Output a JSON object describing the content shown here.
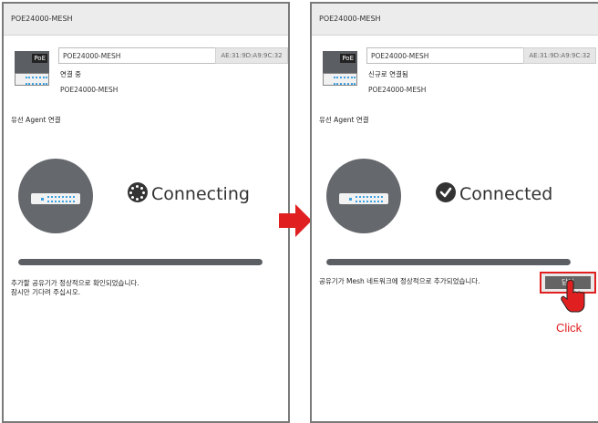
{
  "left_panel": {
    "title": "POE24000-MESH",
    "device_name": "POE24000-MESH",
    "mac": "AE:31:9D:A9:9C:32",
    "status": "연결 중",
    "model": "POE24000-MESH",
    "section_label": "유선 Agent 연결",
    "big_status": "Connecting",
    "progress": 1.0,
    "message_line1": "추가할 공유기가 정상적으로 확인되었습니다.",
    "message_line2": "잠시만 기다려 주십시오."
  },
  "right_panel": {
    "title": "POE24000-MESH",
    "device_name": "POE24000-MESH",
    "mac": "AE:31:9D:A9:9C:32",
    "status": "신규로 연결됨",
    "model": "POE24000-MESH",
    "section_label": "유선 Agent 연결",
    "big_status": "Connected",
    "progress": 1.0,
    "message": "공유기가 Mesh 네트워크에 정상적으로 추가되었습니다.",
    "close_button_label": "닫기",
    "click_label": "Click"
  },
  "badge_text": "PoE",
  "colors": {
    "accent_red": "#e02020",
    "dark_gray": "#5b5f63",
    "port_blue": "#3aa0e0"
  }
}
